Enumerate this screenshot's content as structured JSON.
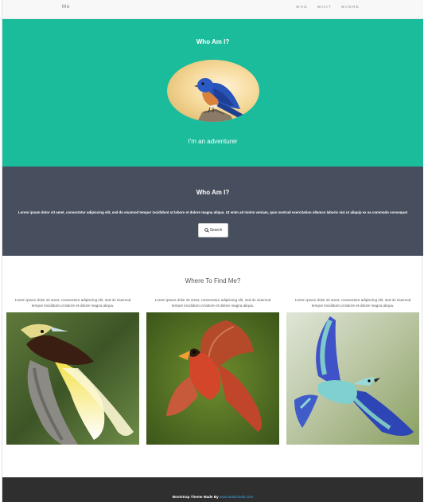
{
  "navbar": {
    "brand": "Me",
    "links": [
      "WHO",
      "WHAT",
      "WHERE"
    ]
  },
  "hero": {
    "title": "Who Am I?",
    "subtitle": "I'm an adventurer"
  },
  "about": {
    "title": "Who Am I?",
    "text": "Lorem ipsum dolor sit amet, consectetur adipiscing elit, sed do eiusmod tempor incididunt ut labore et dolore magna aliqua. Ut enim ad minim veniam, quis nostrud exercitation ullamco laboris nisi ut aliquip ex ea commodo consequat",
    "button_label": "Search"
  },
  "find": {
    "title": "Where To Find Me?",
    "columns": [
      {
        "text": "Lorem ipsum dolor sit amet, consectetur adipiscing elit, sed do eiusmod tempor incididunt ut labore et dolore magna aliqua."
      },
      {
        "text": "Lorem ipsum dolor sit amet, consectetur adipiscing elit, sed do eiusmod tempor incididunt ut labore et dolore magna aliqua."
      },
      {
        "text": "Lorem ipsum dolor sit amet, consectetur adipiscing elit, sed do eiusmod tempor incididunt ut labore et dolore magna aliqua."
      }
    ]
  },
  "footer": {
    "text": "Bootstrap Theme Made By",
    "link": "www.w3schools.com"
  },
  "colors": {
    "hero_bg": "#1abc9c",
    "about_bg": "#474e5d",
    "footer_bg": "#2f2f2f"
  }
}
